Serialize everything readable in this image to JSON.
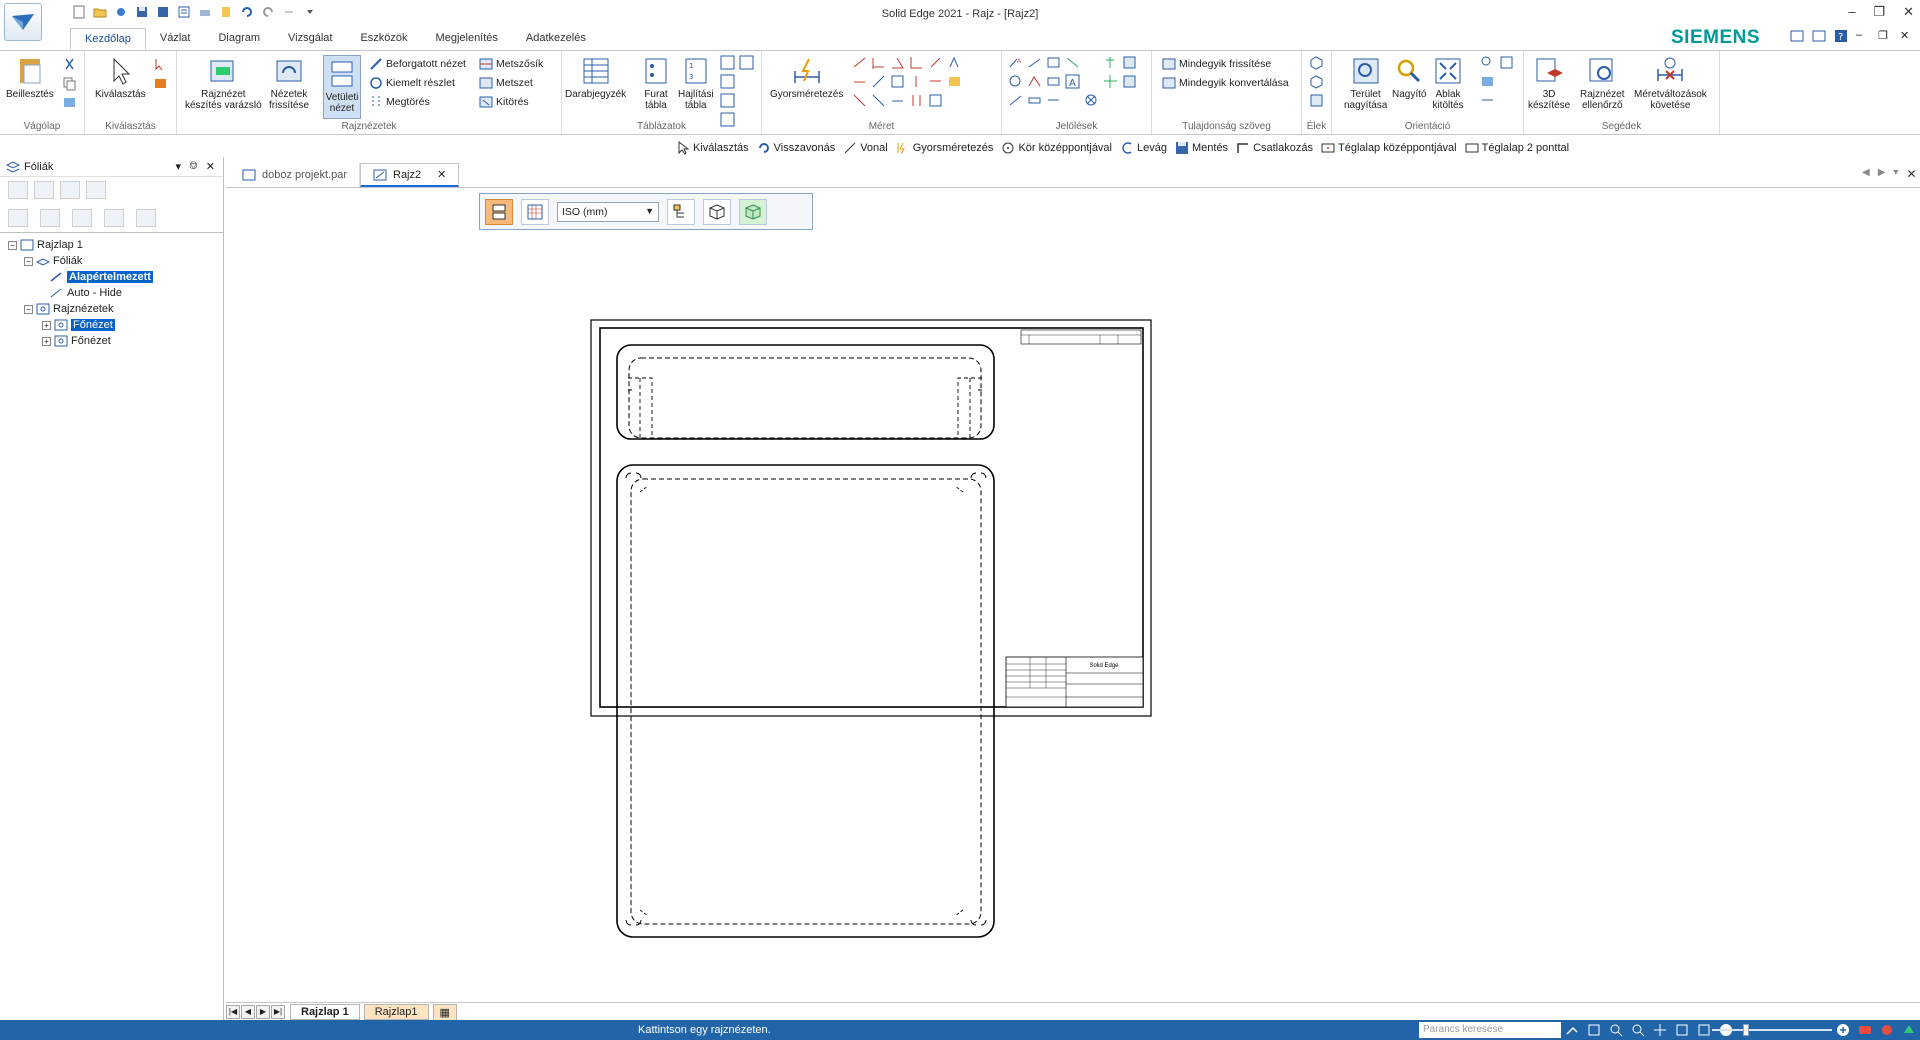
{
  "window": {
    "title": "Solid Edge 2021 - Rajz - [Rajz2]",
    "brand": "SIEMENS"
  },
  "ribbon_tabs": [
    "Kezdőlap",
    "Vázlat",
    "Diagram",
    "Vizsgálat",
    "Eszközök",
    "Megjelenítés",
    "Adatkezelés"
  ],
  "ribbon": {
    "vagolap": {
      "label": "Vágólap",
      "paste": "Beillesztés"
    },
    "kivalasztas": {
      "label": "Kiválasztás",
      "select": "Kiválasztás"
    },
    "rajznezetek": {
      "label": "Rajznézetek",
      "wizard_line1": "Rajznézet",
      "wizard_line2": "készítés varázsló",
      "update_line1": "Nézetek",
      "update_line2": "frissítése",
      "proj_line1": "Vetületi",
      "proj_line2": "nézet",
      "rotated": "Beforgatott nézet",
      "detail": "Kiemelt részlet",
      "broken": "Megtörés",
      "section_plane": "Metszősík",
      "section": "Metszet",
      "cutout": "Kitörés"
    },
    "tablazatok": {
      "label": "Táblázatok",
      "parts_list": "Darabjegyzék",
      "hole_line1": "Furat",
      "hole_line2": "tábla",
      "bend_line1": "Hajlítási",
      "bend_line2": "tábla"
    },
    "meret": {
      "label": "Méret",
      "quick": "Gyorsméretezés"
    },
    "jelolesek": {
      "label": "Jelölések"
    },
    "tulajdonsag": {
      "label": "Tulajdonság szöveg",
      "update_all": "Mindegyik frissítése",
      "convert_all": "Mindegyik konvertálása"
    },
    "elek": {
      "label": "Élek"
    },
    "orientacio": {
      "label": "Orientáció",
      "area_line1": "Terület",
      "area_line2": "nagyítása",
      "zoom": "Nagyító",
      "fit_line1": "Ablak",
      "fit_line2": "kitöltés"
    },
    "segedek": {
      "label": "Segédek",
      "create3d_line1": "3D",
      "create3d_line2": "készítése",
      "checker_line1": "Rajznézet",
      "checker_line2": "ellenőrző",
      "track_line1": "Méretváltozások",
      "track_line2": "követése"
    }
  },
  "command_bar": [
    "Kiválasztás",
    "Visszavonás",
    "Vonal",
    "Gyorsméretezés",
    "Kör középpontjával",
    "Levág",
    "Mentés",
    "Csatlakozás",
    "Téglalap középpontjával",
    "Téglalap 2 ponttal"
  ],
  "left_pane": {
    "title": "Fóliák",
    "tree": {
      "sheet": "Rajzlap 1",
      "layers": "Fóliák",
      "default_layer": "Alapértelmezett",
      "auto_hide": "Auto - Hide",
      "views": "Rajznézetek",
      "main_view_1": "Főnézet",
      "main_view_2": "Főnézet"
    }
  },
  "doc_tabs": [
    "doboz projekt.par",
    "Rajz2"
  ],
  "canvas_toolbar": {
    "standard": "ISO (mm)"
  },
  "title_block": {
    "brand": "Solid Edge"
  },
  "sheet_tabs": [
    "Rajzlap 1",
    "Rajzlap1"
  ],
  "status": {
    "message": "Kattintson egy rajznézeten.",
    "search_placeholder": "Parancs keresése"
  },
  "colors": {
    "accent": "#1a4f9c",
    "statusbar": "#2264a8",
    "selection": "#0a63c9",
    "brand": "#009999"
  }
}
